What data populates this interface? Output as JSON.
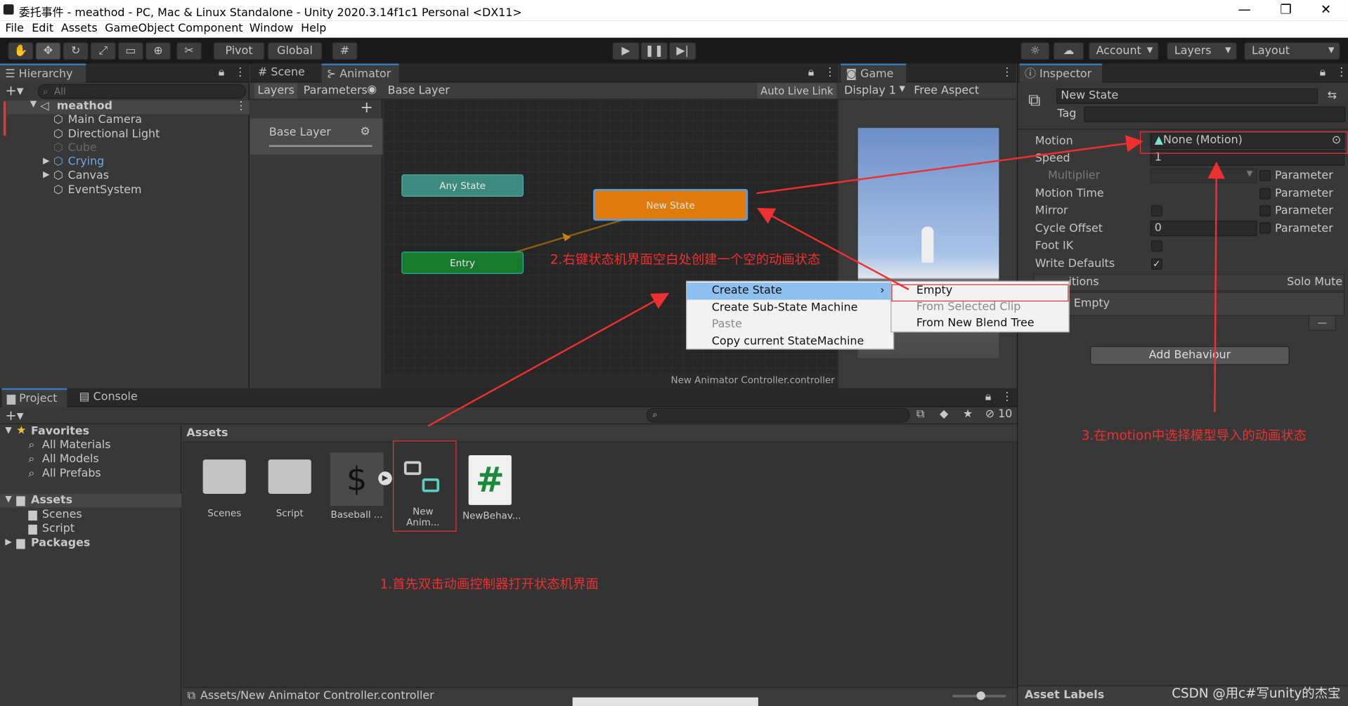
{
  "window": {
    "title": "委托事件 - meathod - PC, Mac & Linux Standalone - Unity 2020.3.14f1c1 Personal <DX11>",
    "minimize": "—",
    "maximize": "❐",
    "close": "✕"
  },
  "menu": [
    "File",
    "Edit",
    "Assets",
    "GameObject",
    "Component",
    "Window",
    "Help"
  ],
  "toolbar": {
    "pivot": "Pivot",
    "global": "Global",
    "account": "Account",
    "layers": "Layers",
    "layout": "Layout"
  },
  "hierarchy": {
    "tab": "Hierarchy",
    "search_placeholder": "All",
    "scene": "meathod",
    "items": [
      "Main Camera",
      "Directional Light",
      "Cube",
      "Crying",
      "Canvas",
      "EventSystem"
    ]
  },
  "scene_tabs": {
    "scene": "Scene",
    "animator": "Animator",
    "game": "Game"
  },
  "animator": {
    "layers_tab": "Layers",
    "parameters_tab": "Parameters",
    "breadcrumb": "Base Layer",
    "auto_live_link": "Auto Live Link",
    "layer_item": "Base Layer",
    "any_state": "Any State",
    "entry": "Entry",
    "new_state": "New State",
    "footer": "New Animator Controller.controller"
  },
  "game": {
    "display": "Display 1",
    "aspect": "Free Aspect"
  },
  "context_menu": {
    "items": [
      "Create State",
      "Create Sub-State Machine",
      "Paste",
      "Copy current StateMachine"
    ],
    "submenu": [
      "Empty",
      "From Selected Clip",
      "From New Blend Tree"
    ]
  },
  "inspector": {
    "tab": "Inspector",
    "name": "New State",
    "tag_label": "Tag",
    "motion_label": "Motion",
    "motion_value": "None (Motion)",
    "speed_label": "Speed",
    "speed_value": "1",
    "multiplier_label": "Multiplier",
    "motion_time_label": "Motion Time",
    "mirror_label": "Mirror",
    "cycle_offset_label": "Cycle Offset",
    "cycle_offset_value": "0",
    "foot_ik_label": "Foot IK",
    "write_defaults_label": "Write Defaults",
    "parameter": "Parameter",
    "transitions_label": "itions",
    "solo": "Solo",
    "mute": "Mute",
    "list_empty": "Empty",
    "list_remove": "—",
    "add_behaviour": "Add Behaviour",
    "asset_labels": "Asset Labels"
  },
  "project": {
    "tab": "Project",
    "console_tab": "Console",
    "favorites": "Favorites",
    "fav_items": [
      "All Materials",
      "All Models",
      "All Prefabs"
    ],
    "assets": "Assets",
    "asset_items": [
      "Scenes",
      "Script"
    ],
    "packages": "Packages",
    "breadcrumb": "Assets",
    "count": "10",
    "footer_path": "Assets/New Animator Controller.controller",
    "grid": [
      "Scenes",
      "Script",
      "Baseball ...",
      "New Anim...",
      "NewBehav..."
    ]
  },
  "annotations": {
    "step1": "1.首先双击动画控制器打开状态机界面",
    "step2": "2.右键状态机界面空白处创建一个空的动画状态",
    "step3": "3.在motion中选择模型导入的动画状态",
    "watermark": "CSDN @用c#写unity的杰宝"
  },
  "colors": {
    "accent": "#3a79bb",
    "annotation": "#ee3030",
    "new_state": "#e07b10",
    "any_state": "#3d8a7e",
    "entry": "#187a2f"
  }
}
